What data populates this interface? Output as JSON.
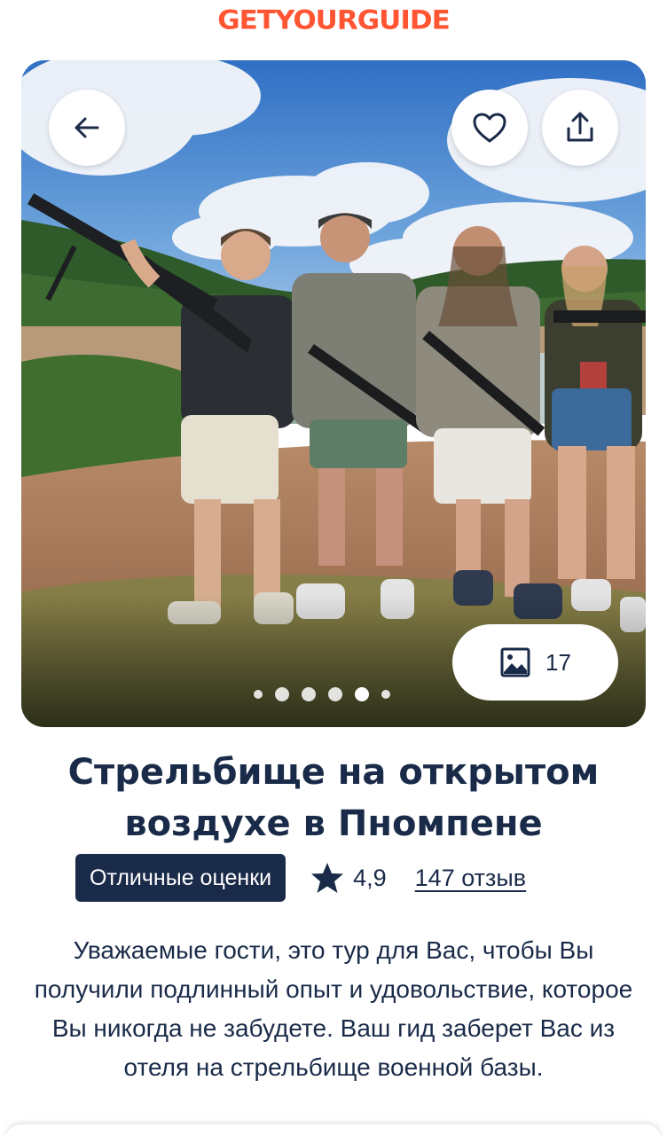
{
  "brand": {
    "logo_text": "GETYOURGUIDE",
    "color": "#ff5533"
  },
  "gallery": {
    "photo_count": "17",
    "dots_total": 6,
    "active_dot": 5
  },
  "header_actions": {
    "back_icon": "arrow-left-icon",
    "favorite_icon": "heart-icon",
    "share_icon": "share-icon"
  },
  "activity": {
    "title": "Стрельбище на открытом воздухе в Пномпене",
    "badge_label": "Отличные оценки",
    "rating": "4,9",
    "reviews_label": "147 отзыв",
    "description": "Уважаемые гости, это тур для Вас, чтобы Вы получили подлинный опыт и удовольствие, которое Вы никогда не забудете. Ваш гид заберет Вас из отеля на стрельбище военной базы."
  },
  "colors": {
    "primary_text": "#1a2b49",
    "badge_bg": "#1a2b49",
    "accent": "#ff5533"
  }
}
